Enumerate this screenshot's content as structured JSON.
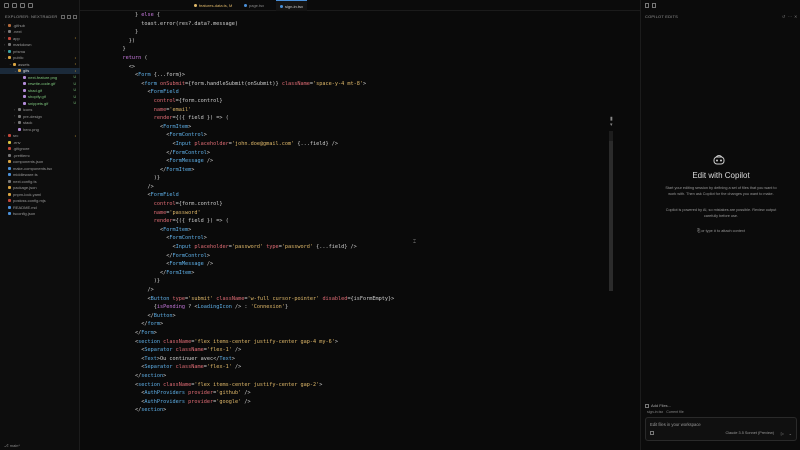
{
  "explorer": {
    "header": "EXPLORER: NEXTRADER",
    "tree": [
      {
        "label": ".github",
        "depth": 0,
        "type": "folder",
        "chev": "›",
        "color": "#b36a3a",
        "status": ""
      },
      {
        "label": ".next",
        "depth": 0,
        "type": "folder",
        "chev": "›",
        "color": "#777",
        "status": ""
      },
      {
        "label": "app",
        "depth": 0,
        "type": "folder",
        "chev": "›",
        "color": "#c4473a",
        "status": "•"
      },
      {
        "label": "markdown",
        "depth": 0,
        "type": "folder",
        "chev": "›",
        "color": "#777",
        "status": ""
      },
      {
        "label": "prisma",
        "depth": 0,
        "type": "folder",
        "chev": "›",
        "color": "#3aa0a0",
        "status": ""
      },
      {
        "label": "public",
        "depth": 0,
        "type": "folder",
        "chev": "⌄",
        "color": "#d9a441",
        "status": "•"
      },
      {
        "label": "assets",
        "depth": 1,
        "type": "folder",
        "chev": "⌄",
        "color": "#d9a441",
        "status": "•"
      },
      {
        "label": "gifs",
        "depth": 2,
        "type": "folder",
        "chev": "⌄",
        "color": "#d9a441",
        "status": "•",
        "selected": true
      },
      {
        "label": "next-feature.png",
        "depth": 3,
        "type": "file",
        "chev": "",
        "color": "#b38cd9",
        "status": "U"
      },
      {
        "label": "rewrite-code.gif",
        "depth": 3,
        "type": "file",
        "chev": "",
        "color": "#b38cd9",
        "status": "U"
      },
      {
        "label": "shad.gif",
        "depth": 3,
        "type": "file",
        "chev": "",
        "color": "#b38cd9",
        "status": "U"
      },
      {
        "label": "shopify.gif",
        "depth": 3,
        "type": "file",
        "chev": "",
        "color": "#b38cd9",
        "status": "U"
      },
      {
        "label": "snippets.gif",
        "depth": 3,
        "type": "file",
        "chev": "",
        "color": "#b38cd9",
        "status": "U"
      },
      {
        "label": "icons",
        "depth": 2,
        "type": "folder",
        "chev": "›",
        "color": "#777",
        "status": ""
      },
      {
        "label": "pre-design",
        "depth": 2,
        "type": "folder",
        "chev": "›",
        "color": "#777",
        "status": ""
      },
      {
        "label": "stack",
        "depth": 2,
        "type": "folder",
        "chev": "›",
        "color": "#777",
        "status": ""
      },
      {
        "label": "hero.png",
        "depth": 2,
        "type": "file",
        "chev": "",
        "color": "#b38cd9",
        "status": ""
      },
      {
        "label": "src",
        "depth": 0,
        "type": "folder",
        "chev": "›",
        "color": "#c4473a",
        "status": "•"
      },
      {
        "label": ".env",
        "depth": 0,
        "type": "file",
        "chev": "",
        "color": "#d9c441",
        "status": ""
      },
      {
        "label": ".gitignore",
        "depth": 0,
        "type": "file",
        "chev": "",
        "color": "#c4473a",
        "status": ""
      },
      {
        "label": ".prettierrc",
        "depth": 0,
        "type": "file",
        "chev": "",
        "color": "#777",
        "status": ""
      },
      {
        "label": "components.json",
        "depth": 0,
        "type": "file",
        "chev": "",
        "color": "#d9a441",
        "status": ""
      },
      {
        "label": "make-components.tsx",
        "depth": 0,
        "type": "file",
        "chev": "",
        "color": "#4a90d9",
        "status": ""
      },
      {
        "label": "middleware.ts",
        "depth": 0,
        "type": "file",
        "chev": "",
        "color": "#4a90d9",
        "status": ""
      },
      {
        "label": "next.config.ts",
        "depth": 0,
        "type": "file",
        "chev": "",
        "color": "#777",
        "status": ""
      },
      {
        "label": "package.json",
        "depth": 0,
        "type": "file",
        "chev": "",
        "color": "#d9a441",
        "status": ""
      },
      {
        "label": "pnpm-lock.yaml",
        "depth": 0,
        "type": "file",
        "chev": "",
        "color": "#d9a441",
        "status": ""
      },
      {
        "label": "postcss.config.mjs",
        "depth": 0,
        "type": "file",
        "chev": "",
        "color": "#c4473a",
        "status": ""
      },
      {
        "label": "README.md",
        "depth": 0,
        "type": "file",
        "chev": "",
        "color": "#4a90d9",
        "status": ""
      },
      {
        "label": "tsconfig.json",
        "depth": 0,
        "type": "file",
        "chev": "",
        "color": "#4a90d9",
        "status": ""
      }
    ],
    "footer": "main*"
  },
  "tabs": [
    {
      "label": "features-data.ts, M",
      "color": "#e0b96a",
      "active": false
    },
    {
      "label": "page.tsx",
      "color": "#888",
      "active": false
    },
    {
      "label": "sign-in.tsx",
      "color": "#ccc",
      "active": true
    }
  ],
  "code_lines": [
    "        } else {",
    "          toast.error(res?.data?.message)",
    "        }",
    "      })",
    "    }",
    "",
    "    return (",
    "      <>",
    "        <Form {...form}>",
    "          <form onSubmit={form.handleSubmit(onSubmit)} className='space-y-4 mt-8'>",
    "            <FormField",
    "              control={form.control}",
    "              name='email'",
    "              render={({ field }) => (",
    "                <FormItem>",
    "                  <FormControl>",
    "                    <Input placeholder='john.doe@gmail.com' {...field} />",
    "                  </FormControl>",
    "                  <FormMessage />",
    "                </FormItem>",
    "              )}",
    "            />",
    "            <FormField",
    "              control={form.control}",
    "              name='password'",
    "              render={({ field }) => (",
    "                <FormItem>",
    "                  <FormControl>",
    "                    <Input placeholder='password' type='password' {...field} />",
    "                  </FormControl>",
    "                  <FormMessage />",
    "                </FormItem>",
    "              )}",
    "            />",
    "            <Button type='submit' className='w-full cursor-pointer' disabled={isFormEmpty}>",
    "              {isPending ? <LoadingIcon /> : 'Connexion'}",
    "            </Button>",
    "          </form>",
    "        </Form>",
    "",
    "        <section className='flex items-center justify-center gap-4 my-6'>",
    "          <Separator className='flex-1' />",
    "          <Text>Ou continuer avec</Text>",
    "          <Separator className='flex-1' />",
    "        </section>",
    "",
    "        <section className='flex items-center justify-center gap-2'>",
    "          <AuthProviders provider='github' />",
    "          <AuthProviders provider='google' />",
    "        </section>"
  ],
  "copilot": {
    "header": "COPILOT EDITS",
    "title": "Edit with Copilot",
    "desc1": "Start your editing session by defining a set of files that you want to work with. Then ask Copilot for the changes you want to make.",
    "desc2": "Copilot is powered by AI, so mistakes are possible. Review output carefully before use.",
    "hint": "or type # to attach context",
    "add_files": "Add Files...",
    "chip_file": "sign-in.tsx",
    "chip_tag": "Current file",
    "input_placeholder": "Edit files in your workspace",
    "model": "Claude 3.5 Sonnet (Preview)",
    "send": "▷",
    "more": "⌄"
  }
}
